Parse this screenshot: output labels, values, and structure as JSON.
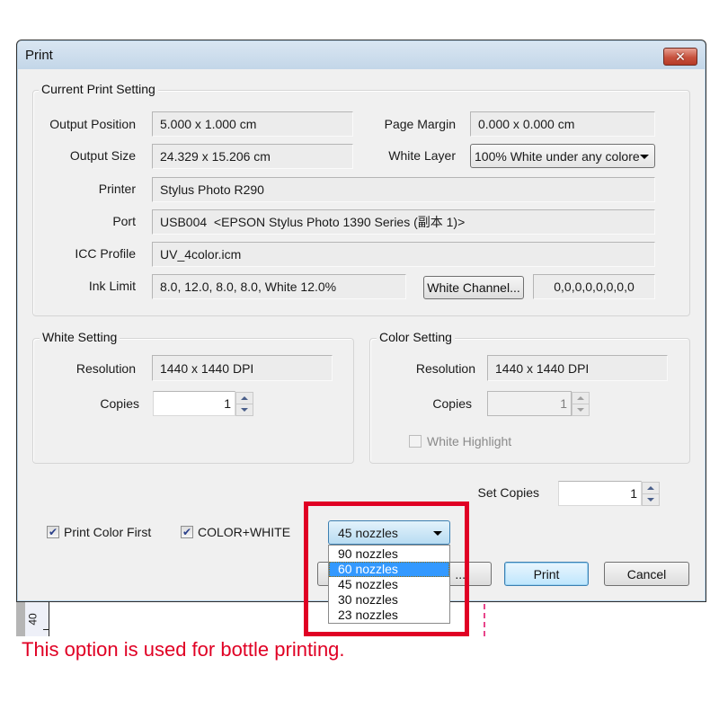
{
  "window": {
    "title": "Print",
    "close_icon": "close-x-icon"
  },
  "current_print_setting": {
    "legend": "Current Print Setting",
    "output_position": {
      "label": "Output Position",
      "value": "5.000 x 1.000 cm"
    },
    "page_margin": {
      "label": "Page Margin",
      "value": "0.000 x 0.000 cm"
    },
    "output_size": {
      "label": "Output Size",
      "value": "24.329 x 15.206 cm"
    },
    "white_layer": {
      "label": "White Layer",
      "value": "100% White under any colore"
    },
    "printer": {
      "label": "Printer",
      "value": "Stylus Photo R290"
    },
    "port": {
      "label": "Port",
      "value": "USB004  <EPSON Stylus Photo 1390 Series (副本 1)>"
    },
    "icc_profile": {
      "label": "ICC Profile",
      "value": "UV_4color.icm"
    },
    "ink_limit": {
      "label": "Ink Limit",
      "value": "8.0, 12.0, 8.0, 8.0, White 12.0%"
    },
    "white_channel_button": "White Channel...",
    "white_channel_value": "0,0,0,0,0,0,0,0"
  },
  "white_setting": {
    "legend": "White Setting",
    "resolution": {
      "label": "Resolution",
      "value": "1440 x 1440 DPI"
    },
    "copies": {
      "label": "Copies",
      "value": "1"
    }
  },
  "color_setting": {
    "legend": "Color Setting",
    "resolution": {
      "label": "Resolution",
      "value": "1440 x 1440 DPI"
    },
    "copies": {
      "label": "Copies",
      "value": "1"
    },
    "white_highlight": {
      "label": "White Highlight",
      "checked": false,
      "enabled": false
    }
  },
  "set_copies": {
    "label": "Set Copies",
    "value": "1"
  },
  "options": {
    "print_color_first": {
      "label": "Print Color First",
      "checked": true
    },
    "color_white": {
      "label": "COLOR+WHITE",
      "checked": true
    }
  },
  "nozzles": {
    "selected": "45 nozzles",
    "highlighted": "60 nozzles",
    "options": [
      "90 nozzles",
      "60 nozzles",
      "45 nozzles",
      "30 nozzles",
      "23 nozzles"
    ]
  },
  "buttons": {
    "hidden_button_suffix": "...",
    "print": "Print",
    "cancel": "Cancel"
  },
  "ruler": {
    "label": "40"
  },
  "annotation": {
    "text": "This option is used for bottle printing.",
    "color": "#e00024"
  }
}
